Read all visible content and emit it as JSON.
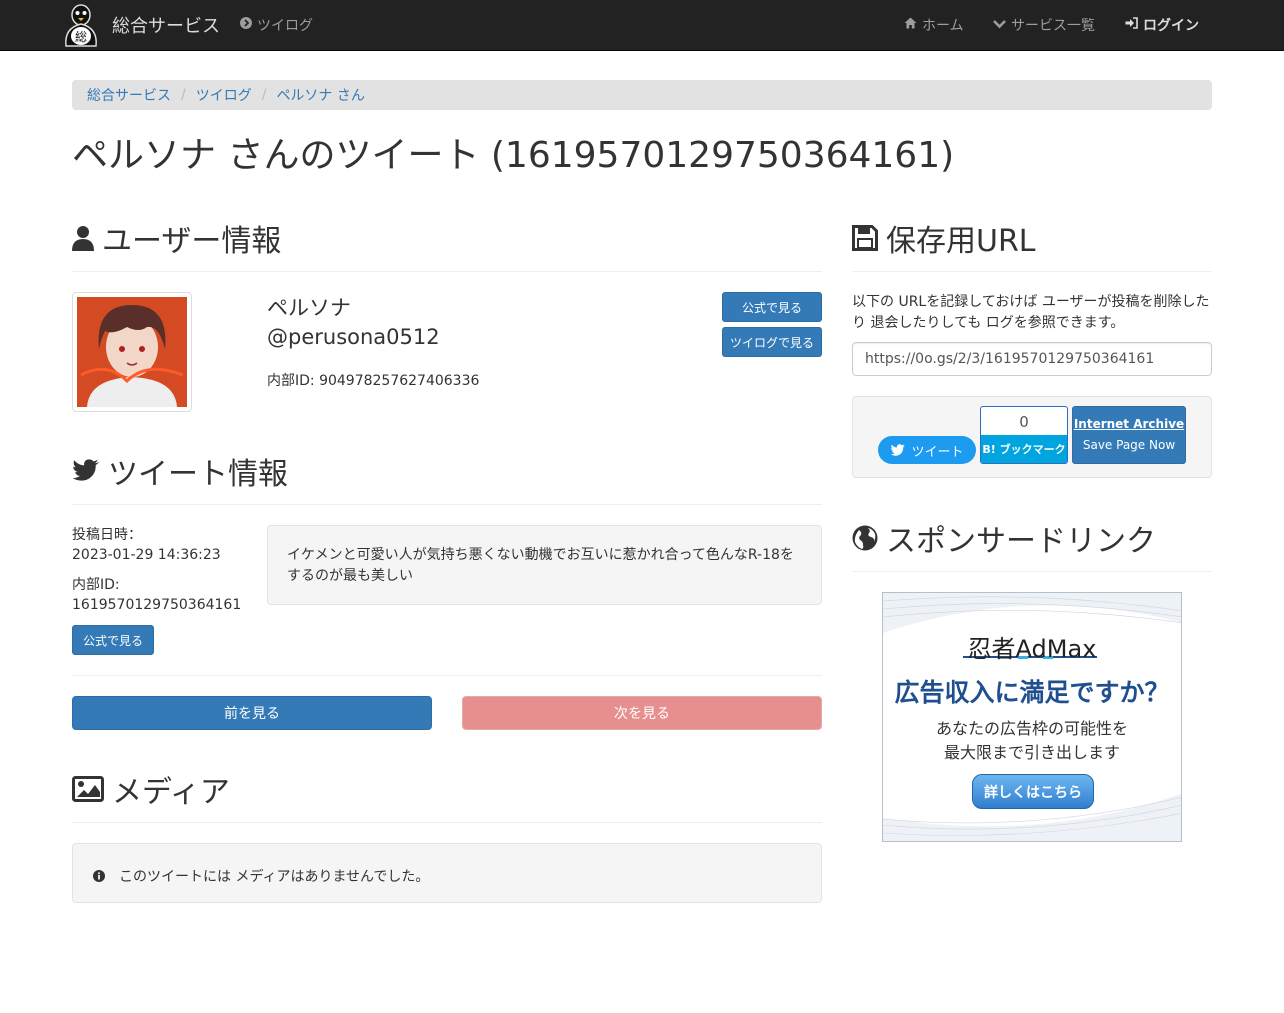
{
  "nav": {
    "brand": "総合サービス",
    "logo_char": "総",
    "twilog": "ツイログ",
    "home": "ホーム",
    "services": "サービス一覧",
    "login": "ログイン"
  },
  "breadcrumb": [
    "総合サービス",
    "ツイログ",
    "ペルソナ さん"
  ],
  "title": "ペルソナ さんのツイート (1619570129750364161)",
  "user_section": {
    "heading": "ユーザー情報",
    "name": "ペルソナ",
    "handle": "@perusona0512",
    "internal_id": "内部ID: 904978257627406336",
    "official_button": "公式で見る",
    "twilog_button": "ツイログで見る"
  },
  "tweet_section": {
    "heading": "ツイート情報",
    "posted_label": "投稿日時：",
    "posted_value": "2023-01-29 14:36:23",
    "id_label": "内部ID:",
    "id_value": "1619570129750364161",
    "official_button": "公式で見る",
    "text": "イケメンと可愛い人が気持ち悪くない動機でお互いに惹かれ合って色んなR-18をするのが最も美しい"
  },
  "pager": {
    "prev": "前を見る",
    "next": "次を見る"
  },
  "media_section": {
    "heading": "メディア",
    "empty_message": "このツイートには メディアはありませんでした。"
  },
  "save_section": {
    "heading": "保存用URL",
    "description": "以下の URLを記録しておけば ユーザーが投稿を削除したり 退会したりしても ログを参照できます。",
    "url": "https://0o.gs/2/3/1619570129750364161",
    "tweet_button": "ツイート",
    "hatena_count": "0",
    "hatena_label": "B! ブックマーク",
    "ia_title": "Internet Archive",
    "ia_sub": "Save Page Now"
  },
  "sponsor_section": {
    "heading": "スポンサードリンク",
    "ad_brand": "忍者AdMax",
    "ad_headline": "広告収入に満足ですか？",
    "ad_line1": "あなたの広告枠の可能性を",
    "ad_line2": "最大限まで引き出します",
    "ad_cta": "詳しくはこちら"
  },
  "colors": {
    "navbar": "#222222",
    "primary": "#337ab7",
    "disabled_danger": "#e78f8e",
    "twitter": "#1d9bf0",
    "hatena": "#00a4de"
  }
}
